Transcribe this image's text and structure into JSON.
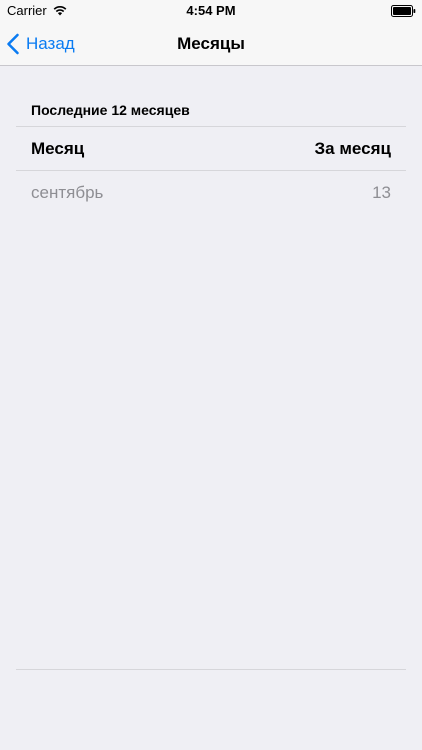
{
  "status_bar": {
    "carrier": "Carrier",
    "time": "4:54 PM",
    "wifi_icon": "wifi-icon",
    "battery_icon": "battery-icon"
  },
  "nav": {
    "back_label": "Назад",
    "back_icon": "chevron-left-icon",
    "title": "Месяцы"
  },
  "section": {
    "header": "Последние 12 месяцев"
  },
  "table": {
    "columns": [
      "Месяц",
      "За месяц"
    ],
    "rows": [
      {
        "month": "сентябрь",
        "value": "13"
      }
    ]
  },
  "colors": {
    "accent": "#0a7bf2",
    "background": "#efeff4",
    "muted_text": "#8e8e93",
    "separator": "#d6d6da"
  }
}
